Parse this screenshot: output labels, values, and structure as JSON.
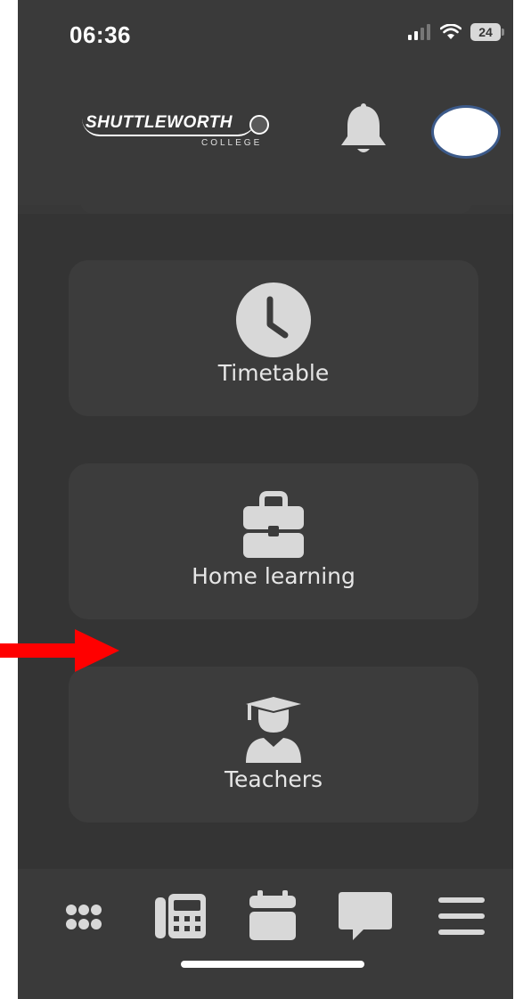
{
  "status_bar": {
    "time": "06:36",
    "battery": "24"
  },
  "header": {
    "logo_main": "SHUTTLEWORTH",
    "logo_sub": "COLLEGE",
    "notification_icon": "bell-icon"
  },
  "tiles": [
    {
      "label": "Timetable",
      "icon": "clock-icon"
    },
    {
      "label": "Home learning",
      "icon": "briefcase-icon"
    },
    {
      "label": "Teachers",
      "icon": "teacher-icon"
    }
  ],
  "bottom_nav": [
    {
      "icon": "grid-icon"
    },
    {
      "icon": "phone-book-icon"
    },
    {
      "icon": "calendar-icon"
    },
    {
      "icon": "chat-icon"
    },
    {
      "icon": "menu-icon"
    }
  ],
  "colors": {
    "background": "#383838",
    "tile": "#3c3c3c",
    "icon": "#d8d8d8",
    "text": "#e6e6e6",
    "annotation_arrow": "#ff0000"
  }
}
